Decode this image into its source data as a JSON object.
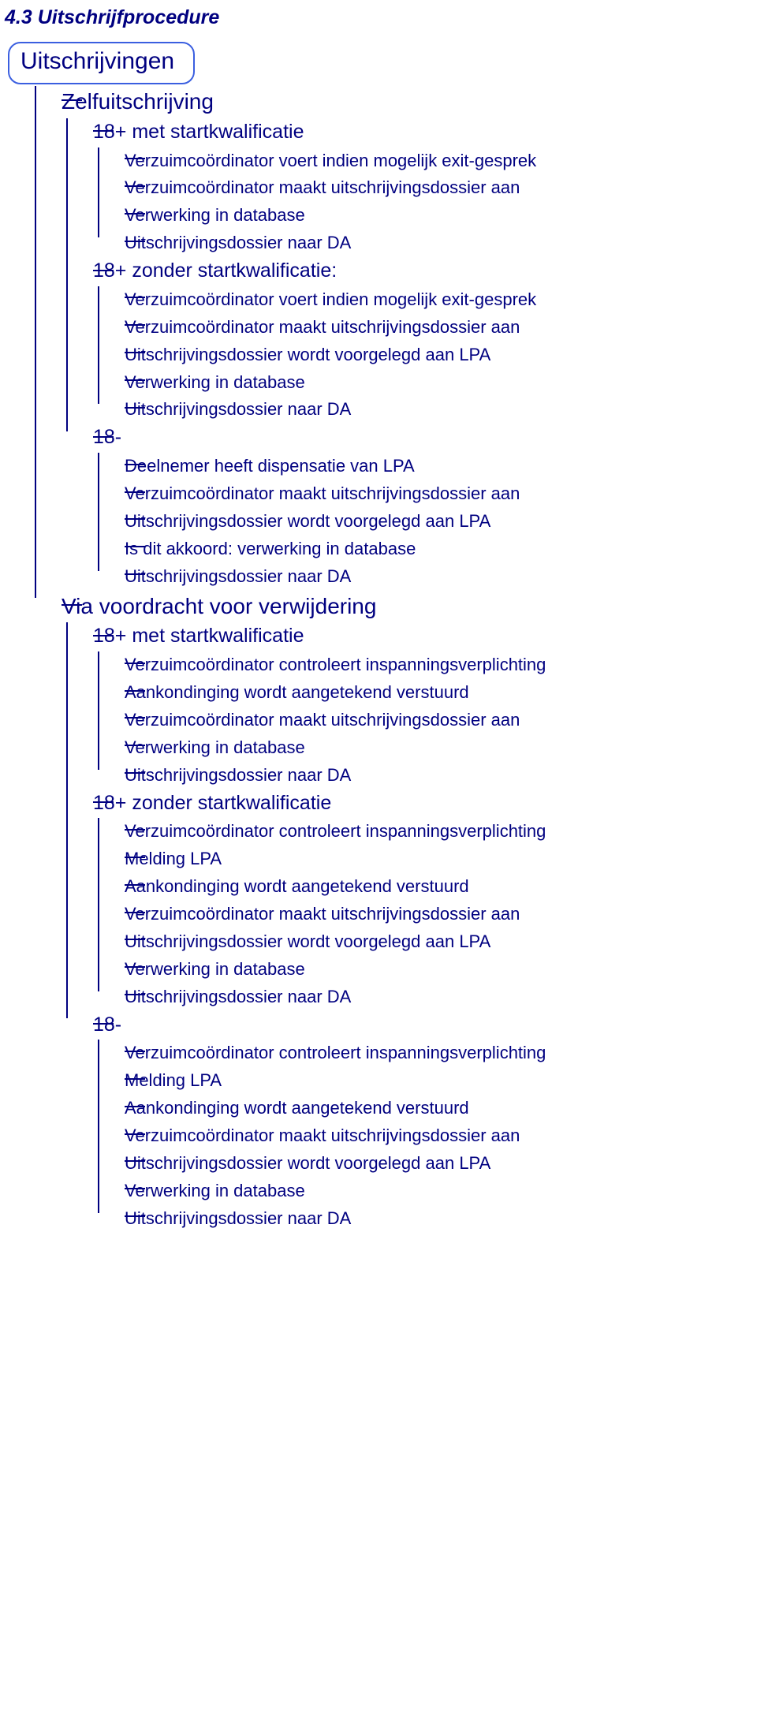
{
  "heading": "4.3 Uitschrijfprocedure",
  "root": "Uitschrijvingen",
  "tree": [
    {
      "label": "Zelfuitschrijving",
      "children": [
        {
          "label": "18+ met startkwalificatie",
          "children": [
            {
              "label": "Verzuimcoördinator voert indien mogelijk exit-gesprek"
            },
            {
              "label": "Verzuimcoördinator maakt uitschrijvingsdossier aan"
            },
            {
              "label": "Verwerking in database"
            },
            {
              "label": "Uitschrijvingsdossier naar DA"
            }
          ]
        },
        {
          "label": "18+ zonder startkwalificatie:",
          "children": [
            {
              "label": "Verzuimcoördinator voert indien mogelijk exit-gesprek"
            },
            {
              "label": "Verzuimcoördinator maakt uitschrijvingsdossier aan"
            },
            {
              "label": "Uitschrijvingsdossier wordt voorgelegd aan LPA"
            },
            {
              "label": "Verwerking in database"
            },
            {
              "label": "Uitschrijvingsdossier naar DA"
            }
          ]
        },
        {
          "label": "18-",
          "children": [
            {
              "label": "Deelnemer heeft dispensatie van LPA"
            },
            {
              "label": "Verzuimcoördinator maakt uitschrijvingsdossier aan"
            },
            {
              "label": "Uitschrijvingsdossier wordt voorgelegd aan LPA"
            },
            {
              "label": "Is dit akkoord: verwerking in database"
            },
            {
              "label": "Uitschrijvingsdossier naar DA"
            }
          ]
        }
      ]
    },
    {
      "label": "Via voordracht voor verwijdering",
      "children": [
        {
          "label": "18+ met startkwalificatie",
          "children": [
            {
              "label": "Verzuimcoördinator controleert inspanningsverplichting"
            },
            {
              "label": "Aankondinging wordt aangetekend verstuurd"
            },
            {
              "label": "Verzuimcoördinator maakt uitschrijvingsdossier aan"
            },
            {
              "label": "Verwerking in database"
            },
            {
              "label": "Uitschrijvingsdossier naar DA"
            }
          ]
        },
        {
          "label": "18+ zonder startkwalificatie",
          "children": [
            {
              "label": "Verzuimcoördinator controleert inspanningsverplichting"
            },
            {
              "label": "Melding LPA"
            },
            {
              "label": "Aankondinging wordt aangetekend verstuurd"
            },
            {
              "label": "Verzuimcoördinator maakt uitschrijvingsdossier aan"
            },
            {
              "label": "Uitschrijvingsdossier wordt voorgelegd aan LPA"
            },
            {
              "label": "Verwerking in database"
            },
            {
              "label": "Uitschrijvingsdossier naar DA"
            }
          ]
        },
        {
          "label": "18-",
          "children": [
            {
              "label": "Verzuimcoördinator controleert inspanningsverplichting"
            },
            {
              "label": "Melding LPA"
            },
            {
              "label": "Aankondinging wordt aangetekend verstuurd"
            },
            {
              "label": "Verzuimcoördinator maakt uitschrijvingsdossier aan"
            },
            {
              "label": "Uitschrijvingsdossier wordt voorgelegd aan LPA"
            },
            {
              "label": "Verwerking in database"
            },
            {
              "label": "Uitschrijvingsdossier naar DA"
            }
          ]
        }
      ]
    }
  ]
}
